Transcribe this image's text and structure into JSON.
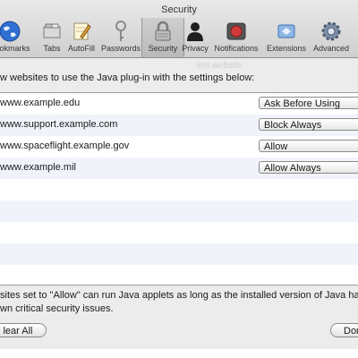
{
  "window": {
    "title": "Security"
  },
  "toolbar": {
    "items": [
      {
        "label": "Bookmarks",
        "icon": "globe-icon"
      },
      {
        "label": "Tabs",
        "icon": "tabs-icon"
      },
      {
        "label": "AutoFill",
        "icon": "autofill-pencil-icon"
      },
      {
        "label": "Passwords",
        "icon": "key-icon"
      },
      {
        "label": "Security",
        "icon": "lock-icon",
        "selected": true
      },
      {
        "label": "Privacy",
        "icon": "privacy-silhouette-icon"
      },
      {
        "label": "Notifications",
        "icon": "notifications-icon"
      },
      {
        "label": "Extensions",
        "icon": "extensions-icon"
      },
      {
        "label": "Advanced",
        "icon": "gear-icon"
      }
    ]
  },
  "content": {
    "faint_header": "ent website",
    "intro": "w websites to use the Java plug-in with the settings below:",
    "rows": [
      {
        "site": "www.example.edu",
        "setting": "Ask Before Using"
      },
      {
        "site": "www.support.example.com",
        "setting": "Block Always"
      },
      {
        "site": "www.spaceflight.example.gov",
        "setting": "Allow"
      },
      {
        "site": "www.example.mil",
        "setting": "Allow Always"
      }
    ],
    "note_line1": "sites set to \"Allow\" can run Java applets as long as the installed version of Java has n",
    "note_line2": "wn critical security issues.",
    "clear_button": "lear All",
    "done_button": "Don"
  },
  "colors": {
    "selection_accent": "#d33b3b",
    "globe_blue": "#2f6fd1",
    "toolbar_top": "#e9e9e9",
    "toolbar_bottom": "#cfcfcf"
  }
}
